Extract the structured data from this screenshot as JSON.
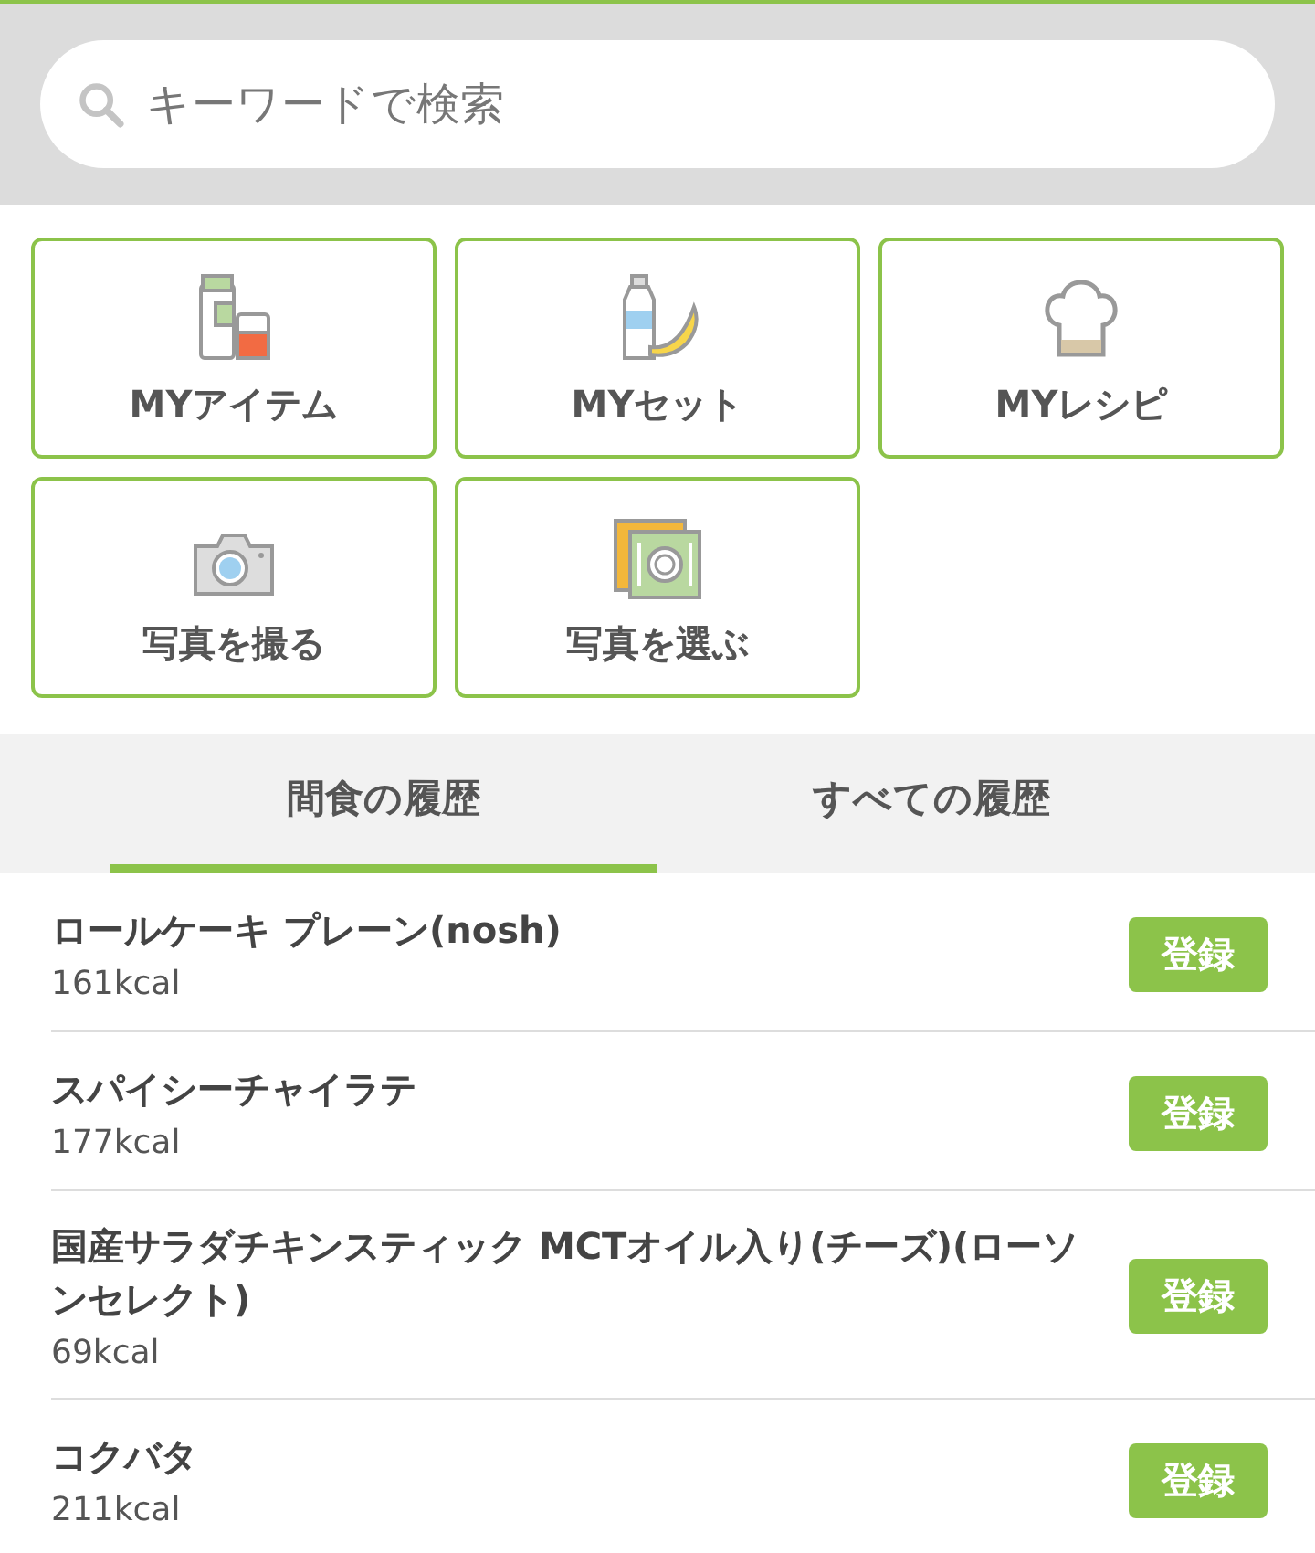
{
  "search": {
    "placeholder": "キーワードで検索"
  },
  "shortcuts": [
    {
      "kind": "item",
      "label": "MYアイテム"
    },
    {
      "kind": "set",
      "label": "MYセット"
    },
    {
      "kind": "recipe",
      "label": "MYレシピ"
    },
    {
      "kind": "camera",
      "label": "写真を撮る"
    },
    {
      "kind": "photo",
      "label": "写真を選ぶ"
    }
  ],
  "tabs": [
    {
      "label": "間食の履歴",
      "selected": true
    },
    {
      "label": "すべての履歴",
      "selected": false
    }
  ],
  "history": [
    {
      "name": "ロールケーキ プレーン(nosh)",
      "calories": "161kcal",
      "button": "登録"
    },
    {
      "name": "スパイシーチャイラテ",
      "calories": "177kcal",
      "button": "登録"
    },
    {
      "name": "国産サラダチキンスティック MCTオイル入り(チーズ)(ローソンセレクト)",
      "calories": "69kcal",
      "button": "登録"
    },
    {
      "name": "コクバタ",
      "calories": "211kcal",
      "button": "登録"
    }
  ]
}
